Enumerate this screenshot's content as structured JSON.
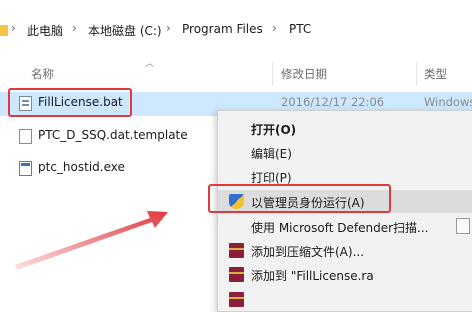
{
  "breadcrumb": {
    "items": [
      "此电脑",
      "本地磁盘 (C:)",
      "Program Files",
      "PTC"
    ],
    "separator": "›"
  },
  "columns": {
    "name": "名称",
    "date": "修改日期",
    "type": "类型"
  },
  "files": [
    {
      "name": "FillLicense.bat",
      "date": "2016/12/17 22:06",
      "type": "Windows",
      "icon": "bat-file-icon"
    },
    {
      "name": "PTC_D_SSQ.dat.template",
      "date": "",
      "type": "",
      "icon": "document-icon"
    },
    {
      "name": "ptc_hostid.exe",
      "date": "",
      "type": "",
      "icon": "exe-icon"
    }
  ],
  "context_menu": {
    "items": [
      {
        "label": "打开(O)",
        "bold": true
      },
      {
        "label": "编辑(E)"
      },
      {
        "label": "打印(P)"
      },
      {
        "label": "以管理员身份运行(A)",
        "icon": "shield-icon"
      },
      {
        "label": "使用 Microsoft Defender扫描..."
      },
      {
        "label": "添加到压缩文件(A)...",
        "icon": "winrar-icon"
      },
      {
        "label": "添加到 \"FillLicense.ra",
        "icon": "winrar-icon"
      }
    ]
  },
  "colors": {
    "highlight_red": "#e0393e",
    "selection": "#cde8ff",
    "menu_bg": "#f2f2f2"
  }
}
